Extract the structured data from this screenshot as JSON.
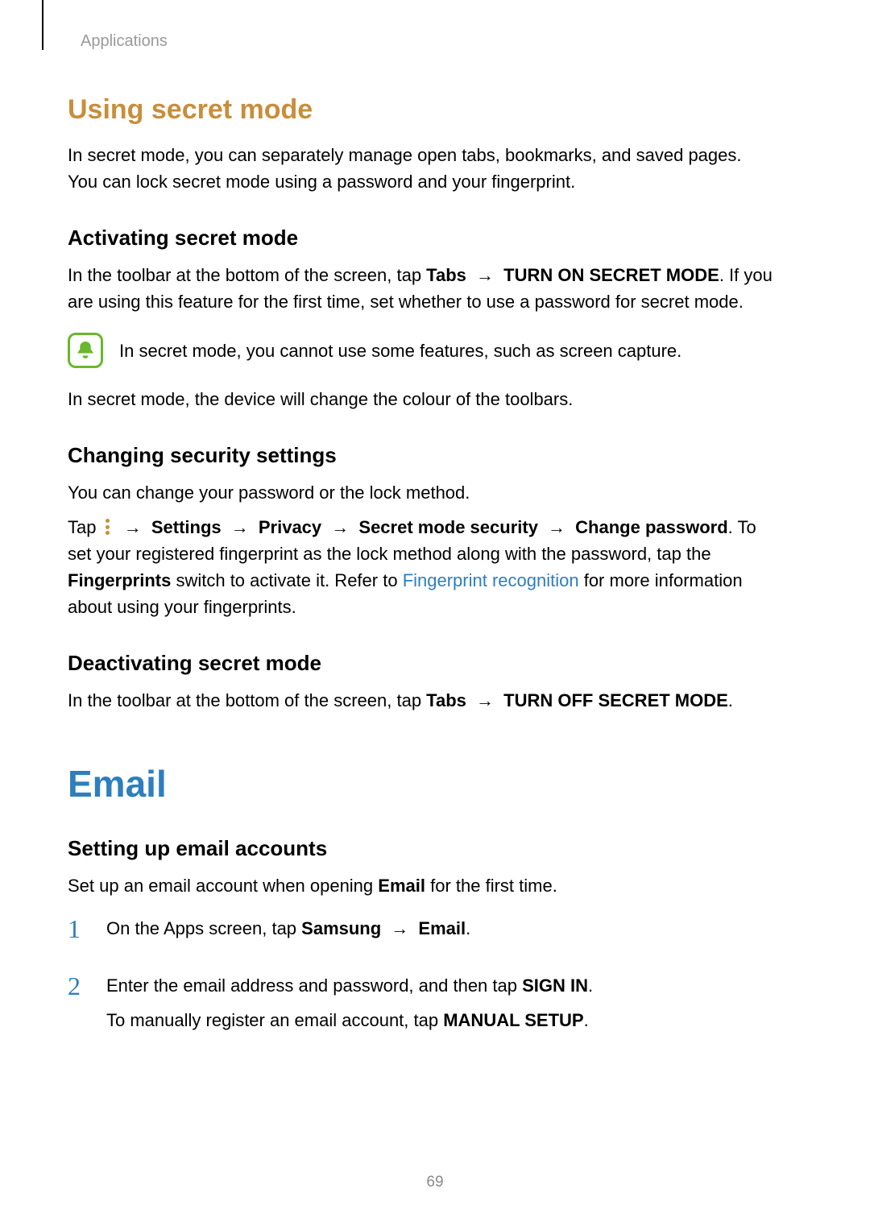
{
  "breadcrumb": "Applications",
  "section1": {
    "title": "Using secret mode",
    "intro": "In secret mode, you can separately manage open tabs, bookmarks, and saved pages. You can lock secret mode using a password and your fingerprint.",
    "sub1": {
      "heading": "Activating secret mode",
      "p1_a": "In the toolbar at the bottom of the screen, tap ",
      "p1_tabs": "Tabs",
      "p1_arrow": " → ",
      "p1_mode": "TURN ON SECRET MODE",
      "p1_b": ". If you are using this feature for the first time, set whether to use a password for secret mode.",
      "note": "In secret mode, you cannot use some features, such as screen capture.",
      "p2": "In secret mode, the device will change the colour of the toolbars."
    },
    "sub2": {
      "heading": "Changing security settings",
      "p1": "You can change your password or the lock method.",
      "p2_a": "Tap ",
      "p2_b": " → ",
      "settings": "Settings",
      "privacy": "Privacy",
      "sms": "Secret mode security",
      "chpw": "Change password",
      "p2_c": ". To set your registered fingerprint as the lock method along with the password, tap the ",
      "fingerprints": "Fingerprints",
      "p2_d": " switch to activate it. Refer to ",
      "link": "Fingerprint recognition",
      "p2_e": " for more information about using your fingerprints."
    },
    "sub3": {
      "heading": "Deactivating secret mode",
      "p1_a": "In the toolbar at the bottom of the screen, tap ",
      "tabs": "Tabs",
      "arrow": " → ",
      "mode": "TURN OFF SECRET MODE",
      "p1_b": "."
    }
  },
  "section2": {
    "title": "Email",
    "sub1": {
      "heading": "Setting up email accounts",
      "intro_a": "Set up an email account when opening ",
      "intro_bold": "Email",
      "intro_b": " for the first time.",
      "steps": [
        {
          "num": "1",
          "a": "On the Apps screen, tap ",
          "b1": "Samsung",
          "arrow": " → ",
          "b2": "Email",
          "c": "."
        },
        {
          "num": "2",
          "a": "Enter the email address and password, and then tap ",
          "b1": "SIGN IN",
          "c": ".",
          "d": "To manually register an email account, tap ",
          "b2": "MANUAL SETUP",
          "e": "."
        }
      ]
    }
  },
  "pageNumber": "69"
}
